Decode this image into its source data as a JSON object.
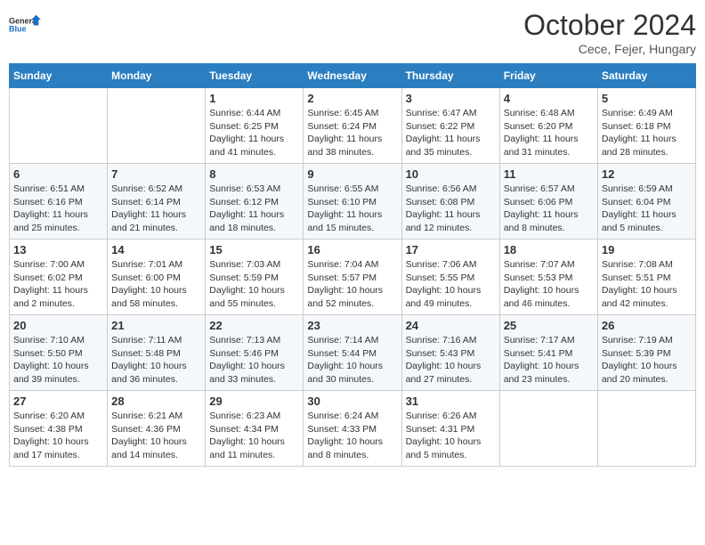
{
  "logo": {
    "line1": "General",
    "line2": "Blue"
  },
  "title": "October 2024",
  "subtitle": "Cece, Fejer, Hungary",
  "days_header": [
    "Sunday",
    "Monday",
    "Tuesday",
    "Wednesday",
    "Thursday",
    "Friday",
    "Saturday"
  ],
  "weeks": [
    [
      {
        "day": "",
        "info": ""
      },
      {
        "day": "",
        "info": ""
      },
      {
        "day": "1",
        "info": "Sunrise: 6:44 AM\nSunset: 6:25 PM\nDaylight: 11 hours and 41 minutes."
      },
      {
        "day": "2",
        "info": "Sunrise: 6:45 AM\nSunset: 6:24 PM\nDaylight: 11 hours and 38 minutes."
      },
      {
        "day": "3",
        "info": "Sunrise: 6:47 AM\nSunset: 6:22 PM\nDaylight: 11 hours and 35 minutes."
      },
      {
        "day": "4",
        "info": "Sunrise: 6:48 AM\nSunset: 6:20 PM\nDaylight: 11 hours and 31 minutes."
      },
      {
        "day": "5",
        "info": "Sunrise: 6:49 AM\nSunset: 6:18 PM\nDaylight: 11 hours and 28 minutes."
      }
    ],
    [
      {
        "day": "6",
        "info": "Sunrise: 6:51 AM\nSunset: 6:16 PM\nDaylight: 11 hours and 25 minutes."
      },
      {
        "day": "7",
        "info": "Sunrise: 6:52 AM\nSunset: 6:14 PM\nDaylight: 11 hours and 21 minutes."
      },
      {
        "day": "8",
        "info": "Sunrise: 6:53 AM\nSunset: 6:12 PM\nDaylight: 11 hours and 18 minutes."
      },
      {
        "day": "9",
        "info": "Sunrise: 6:55 AM\nSunset: 6:10 PM\nDaylight: 11 hours and 15 minutes."
      },
      {
        "day": "10",
        "info": "Sunrise: 6:56 AM\nSunset: 6:08 PM\nDaylight: 11 hours and 12 minutes."
      },
      {
        "day": "11",
        "info": "Sunrise: 6:57 AM\nSunset: 6:06 PM\nDaylight: 11 hours and 8 minutes."
      },
      {
        "day": "12",
        "info": "Sunrise: 6:59 AM\nSunset: 6:04 PM\nDaylight: 11 hours and 5 minutes."
      }
    ],
    [
      {
        "day": "13",
        "info": "Sunrise: 7:00 AM\nSunset: 6:02 PM\nDaylight: 11 hours and 2 minutes."
      },
      {
        "day": "14",
        "info": "Sunrise: 7:01 AM\nSunset: 6:00 PM\nDaylight: 10 hours and 58 minutes."
      },
      {
        "day": "15",
        "info": "Sunrise: 7:03 AM\nSunset: 5:59 PM\nDaylight: 10 hours and 55 minutes."
      },
      {
        "day": "16",
        "info": "Sunrise: 7:04 AM\nSunset: 5:57 PM\nDaylight: 10 hours and 52 minutes."
      },
      {
        "day": "17",
        "info": "Sunrise: 7:06 AM\nSunset: 5:55 PM\nDaylight: 10 hours and 49 minutes."
      },
      {
        "day": "18",
        "info": "Sunrise: 7:07 AM\nSunset: 5:53 PM\nDaylight: 10 hours and 46 minutes."
      },
      {
        "day": "19",
        "info": "Sunrise: 7:08 AM\nSunset: 5:51 PM\nDaylight: 10 hours and 42 minutes."
      }
    ],
    [
      {
        "day": "20",
        "info": "Sunrise: 7:10 AM\nSunset: 5:50 PM\nDaylight: 10 hours and 39 minutes."
      },
      {
        "day": "21",
        "info": "Sunrise: 7:11 AM\nSunset: 5:48 PM\nDaylight: 10 hours and 36 minutes."
      },
      {
        "day": "22",
        "info": "Sunrise: 7:13 AM\nSunset: 5:46 PM\nDaylight: 10 hours and 33 minutes."
      },
      {
        "day": "23",
        "info": "Sunrise: 7:14 AM\nSunset: 5:44 PM\nDaylight: 10 hours and 30 minutes."
      },
      {
        "day": "24",
        "info": "Sunrise: 7:16 AM\nSunset: 5:43 PM\nDaylight: 10 hours and 27 minutes."
      },
      {
        "day": "25",
        "info": "Sunrise: 7:17 AM\nSunset: 5:41 PM\nDaylight: 10 hours and 23 minutes."
      },
      {
        "day": "26",
        "info": "Sunrise: 7:19 AM\nSunset: 5:39 PM\nDaylight: 10 hours and 20 minutes."
      }
    ],
    [
      {
        "day": "27",
        "info": "Sunrise: 6:20 AM\nSunset: 4:38 PM\nDaylight: 10 hours and 17 minutes."
      },
      {
        "day": "28",
        "info": "Sunrise: 6:21 AM\nSunset: 4:36 PM\nDaylight: 10 hours and 14 minutes."
      },
      {
        "day": "29",
        "info": "Sunrise: 6:23 AM\nSunset: 4:34 PM\nDaylight: 10 hours and 11 minutes."
      },
      {
        "day": "30",
        "info": "Sunrise: 6:24 AM\nSunset: 4:33 PM\nDaylight: 10 hours and 8 minutes."
      },
      {
        "day": "31",
        "info": "Sunrise: 6:26 AM\nSunset: 4:31 PM\nDaylight: 10 hours and 5 minutes."
      },
      {
        "day": "",
        "info": ""
      },
      {
        "day": "",
        "info": ""
      }
    ]
  ]
}
